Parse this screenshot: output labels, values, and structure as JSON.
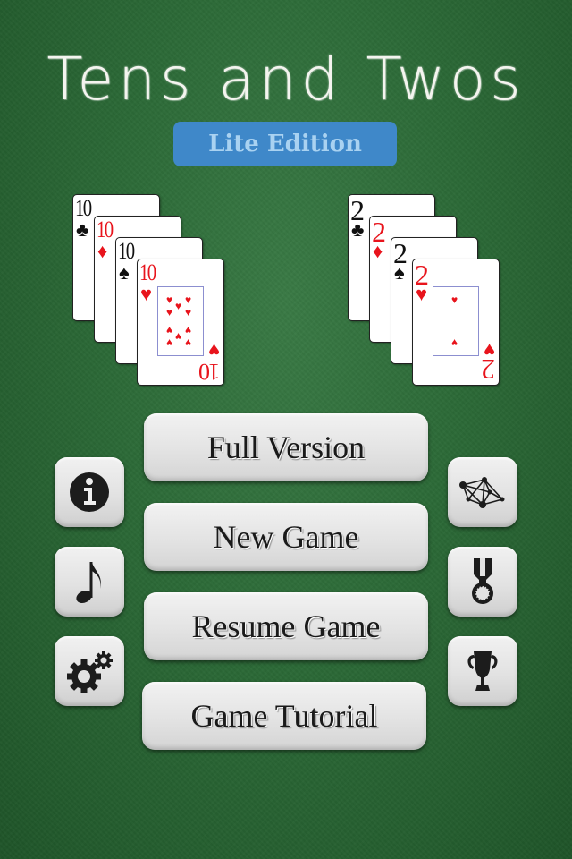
{
  "app": {
    "title": "Tens and Twos",
    "edition_badge": "Lite Edition"
  },
  "colors": {
    "felt": "#2c6a37",
    "badge_bg": "#3f88c9",
    "badge_text": "#a9d2f1",
    "card_red": "#e8141c",
    "card_black": "#111111"
  },
  "card_fans": {
    "tens": {
      "cards": [
        {
          "rank": "10",
          "suit": "♣",
          "suit_name": "clubs",
          "color": "black"
        },
        {
          "rank": "10",
          "suit": "♦",
          "suit_name": "diamonds",
          "color": "red"
        },
        {
          "rank": "10",
          "suit": "♠",
          "suit_name": "spades",
          "color": "black"
        },
        {
          "rank": "10",
          "suit": "♥",
          "suit_name": "hearts",
          "color": "red"
        }
      ]
    },
    "twos": {
      "cards": [
        {
          "rank": "2",
          "suit": "♣",
          "suit_name": "clubs",
          "color": "black"
        },
        {
          "rank": "2",
          "suit": "♦",
          "suit_name": "diamonds",
          "color": "red"
        },
        {
          "rank": "2",
          "suit": "♠",
          "suit_name": "spades",
          "color": "black"
        },
        {
          "rank": "2",
          "suit": "♥",
          "suit_name": "hearts",
          "color": "red"
        }
      ]
    }
  },
  "menu": {
    "buttons": [
      {
        "label": "Full Version"
      },
      {
        "label": "New Game"
      },
      {
        "label": "Resume Game"
      },
      {
        "label": "Game Tutorial"
      }
    ]
  },
  "side_icons": {
    "left": [
      {
        "icon": "info-icon"
      },
      {
        "icon": "music-note-icon"
      },
      {
        "icon": "gears-icon"
      }
    ],
    "right": [
      {
        "icon": "network-icon"
      },
      {
        "icon": "medal-icon"
      },
      {
        "icon": "trophy-icon"
      }
    ]
  }
}
